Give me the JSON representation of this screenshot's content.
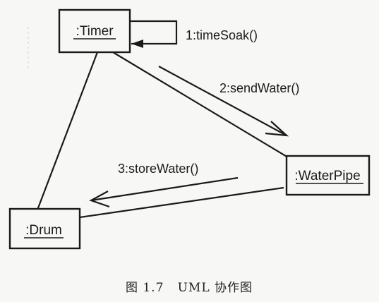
{
  "objects": {
    "timer": ":Timer",
    "waterpipe": ":WaterPipe",
    "drum": ":Drum"
  },
  "messages": {
    "m1": "1:timeSoak()",
    "m2": "2:sendWater()",
    "m3": "3:storeWater()"
  },
  "caption": "图 1.7   UML 协作图"
}
